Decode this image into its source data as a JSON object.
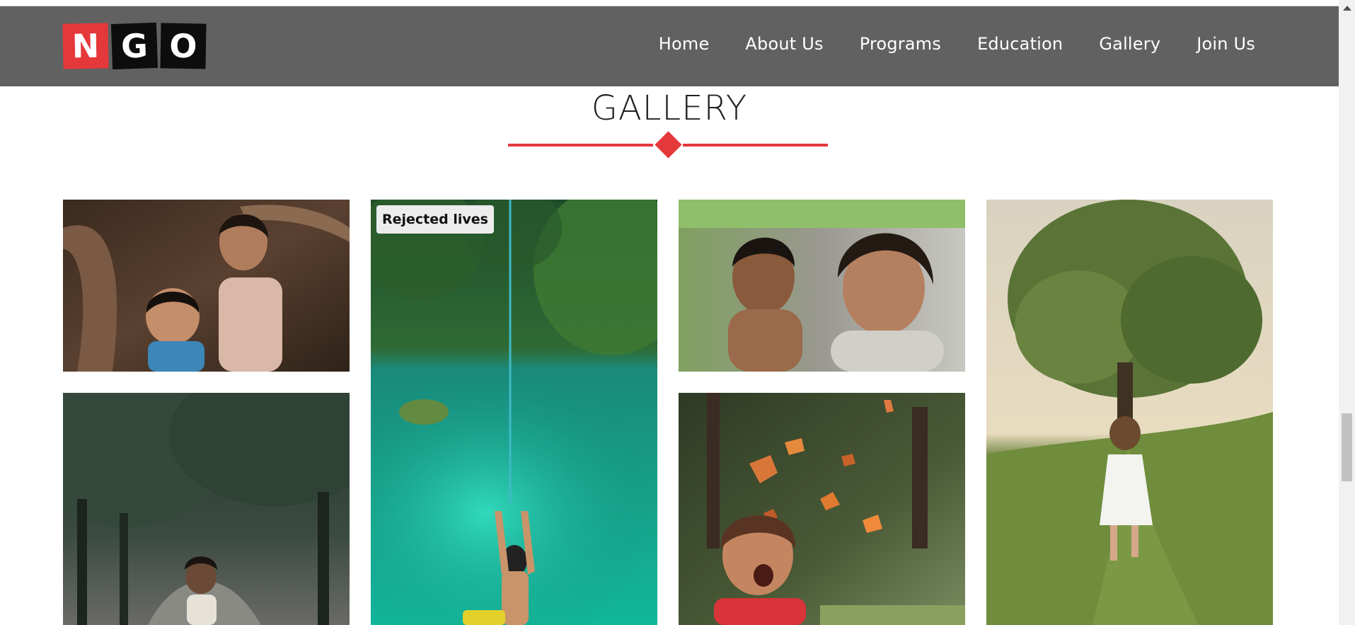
{
  "logo": {
    "letters": [
      "N",
      "G",
      "O"
    ]
  },
  "nav": {
    "items": [
      "Home",
      "About Us",
      "Programs",
      "Education",
      "Gallery",
      "Join Us"
    ]
  },
  "gallery": {
    "title": "GALLERY",
    "photos": [
      {
        "name": "two-children-smiling-photo"
      },
      {
        "name": "turquoise-pool-rope-swing-photo",
        "caption": "Rejected lives"
      },
      {
        "name": "boy-and-girl-smiling-photo"
      },
      {
        "name": "girl-running-in-field-photo"
      },
      {
        "name": "child-in-forest-path-photo"
      },
      {
        "name": "laughing-child-leaves-photo"
      }
    ]
  },
  "colors": {
    "accent": "#e5383b",
    "header_bg": "#616161",
    "nav_text": "#ffffff"
  }
}
